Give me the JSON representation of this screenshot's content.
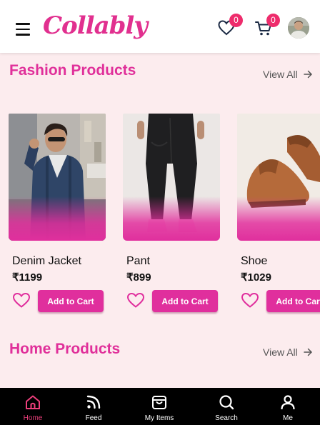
{
  "app": {
    "logo_text": "Collably"
  },
  "header": {
    "wishlist_count": "0",
    "cart_count": "0",
    "icons": [
      "menu-icon",
      "heart-icon",
      "cart-icon",
      "avatar"
    ]
  },
  "sections": [
    {
      "title": "Fashion Products",
      "view_all": "View All",
      "products": [
        {
          "name": "Denim Jacket",
          "price": "₹1199",
          "button": "Add to Cart",
          "image": "man-in-denim-jacket"
        },
        {
          "name": "Pant",
          "price": "₹899",
          "button": "Add to Cart",
          "image": "black-trousers"
        },
        {
          "name": "Shoe",
          "price": "₹1029",
          "button": "Add to Cart",
          "image": "brown-leather-shoes"
        }
      ]
    },
    {
      "title": "Home Products",
      "view_all": "View All"
    }
  ],
  "nav": {
    "items": [
      {
        "label": "Home",
        "icon": "home-icon",
        "active": true
      },
      {
        "label": "Feed",
        "icon": "rss-icon",
        "active": false
      },
      {
        "label": "My Items",
        "icon": "bag-icon",
        "active": false
      },
      {
        "label": "Search",
        "icon": "search-icon",
        "active": false
      },
      {
        "label": "Me",
        "icon": "user-icon",
        "active": false
      }
    ]
  },
  "colors": {
    "accent": "#e02f9d",
    "background": "#fcecee",
    "badge": "#ee2c6c",
    "nav_active": "#ee3f7c"
  }
}
